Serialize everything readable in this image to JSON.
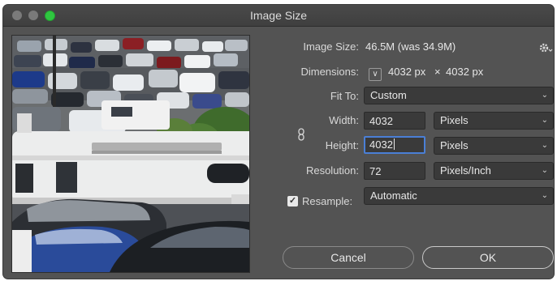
{
  "window": {
    "title": "Image Size"
  },
  "image_size": {
    "label": "Image Size:",
    "value": "46.5M (was 34.9M)",
    "gear_icon": "gear-icon"
  },
  "dimensions": {
    "label": "Dimensions:",
    "width": "4032 px",
    "times": "×",
    "height": "4032 px",
    "toggle_glyph": "∨"
  },
  "fit_to": {
    "label": "Fit To:",
    "value": "Custom"
  },
  "width": {
    "label": "Width:",
    "value": "4032",
    "unit": "Pixels"
  },
  "height": {
    "label": "Height:",
    "value": "4032",
    "unit": "Pixels"
  },
  "resolution": {
    "label": "Resolution:",
    "value": "72",
    "unit": "Pixels/Inch"
  },
  "resample": {
    "label": "Resample:",
    "checked": true,
    "check_glyph": "✓",
    "value": "Automatic"
  },
  "buttons": {
    "cancel": "Cancel",
    "ok": "OK"
  },
  "dropdown_glyph": "⌄",
  "colors": {
    "panel": "#535353",
    "field": "#3a3a3a",
    "focus_ring": "#4a7fd6",
    "zoom_button": "#2fc640"
  }
}
